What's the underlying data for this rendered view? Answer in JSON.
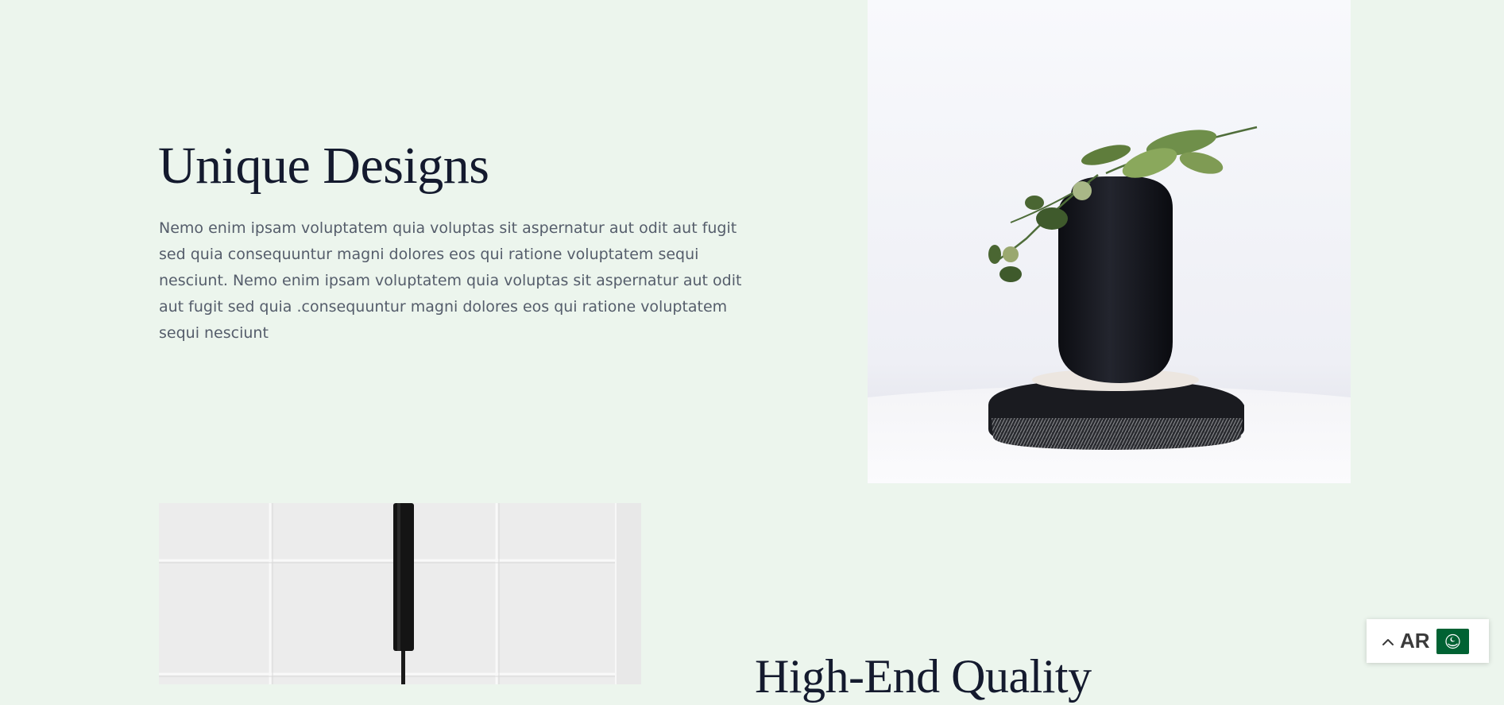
{
  "section1": {
    "title": "Unique Designs",
    "body": "Nemo enim ipsam voluptatem quia voluptas sit aspernatur aut odit aut fugit sed quia consequuntur magni dolores eos qui ratione voluptatem sequi nesciunt. Nemo enim ipsam voluptatem quia voluptas sit aspernatur aut odit aut fugit sed quia .consequuntur magni dolores eos qui ratione voluptatem sequi nesciunt"
  },
  "section2": {
    "title": "High-End Quality"
  },
  "language_switcher": {
    "code": "AR",
    "chevron_icon": "chevron-up-icon",
    "flag_icon": "arab-league-flag-icon",
    "flag_color": "#006233"
  },
  "colors": {
    "background": "#ecf5ed",
    "heading": "#141a2e",
    "body_text": "#555d6b"
  }
}
